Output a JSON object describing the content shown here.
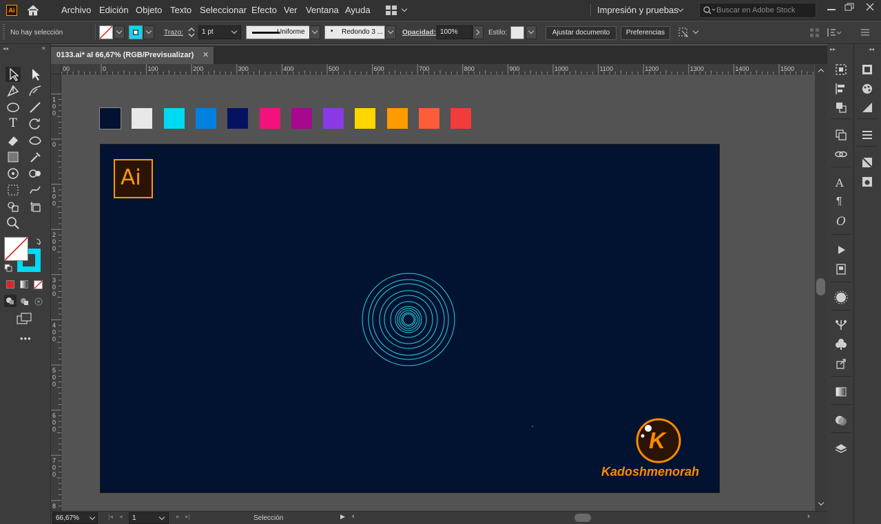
{
  "app": {
    "icon_label": "Ai"
  },
  "menus": [
    "Archivo",
    "Edición",
    "Objeto",
    "Texto",
    "Seleccionar",
    "Efecto",
    "Ver",
    "Ventana",
    "Ayuda"
  ],
  "workspace_switcher": "Impresión y pruebas",
  "search": {
    "placeholder": "Buscar en Adobe Stock"
  },
  "control": {
    "selection_status": "No hay selección",
    "stroke_label": "Trazo:",
    "stroke_weight": "1 pt",
    "stroke_profile": "Uniforme",
    "brush": "Redondo 3 ...",
    "opacity_label": "Opacidad:",
    "opacity": "100%",
    "style_label": "Estilo:",
    "fit_document_button": "Ajustar documento",
    "preferences_button": "Preferencias"
  },
  "document_tab": {
    "title": "0133.ai* al 66,67% (RGB/Previsualizar)",
    "close": "✕"
  },
  "ruler": {
    "h_labels": [
      "00",
      "0",
      "100",
      "200",
      "300",
      "400",
      "500",
      "600",
      "700",
      "800",
      "900",
      "1000",
      "1100",
      "1200",
      "1300",
      "1400",
      "1500"
    ],
    "v_labels": [
      "1\n0\n0",
      "0",
      "1\n0\n0",
      "2\n0\n0",
      "3\n0\n0",
      "4\n0\n0",
      "5\n0\n0",
      "6\n0\n0",
      "7\n0\n0",
      "8\n0\n0"
    ]
  },
  "swatches": [
    "#011331",
    "#e8e8e8",
    "#00d9f4",
    "#0080e0",
    "#061161",
    "#f2127b",
    "#a6098f",
    "#8a39e6",
    "#ffd600",
    "#ff9a00",
    "#ff5c3a",
    "#f23b3b"
  ],
  "artboard": {
    "background": "#011331",
    "ai_logo_text": "Ai",
    "ai_logo_color": "#ff9a00",
    "circles_color": "#2bd2e8",
    "watermark_letter": "K",
    "watermark_text": "Kadoshmenorah",
    "watermark_color": "#ff8a00"
  },
  "status": {
    "zoom": "66,67%",
    "artboard_number": "1",
    "tool_name": "Selección"
  },
  "fill_stroke": {
    "stroke_color": "#00d9f4"
  }
}
